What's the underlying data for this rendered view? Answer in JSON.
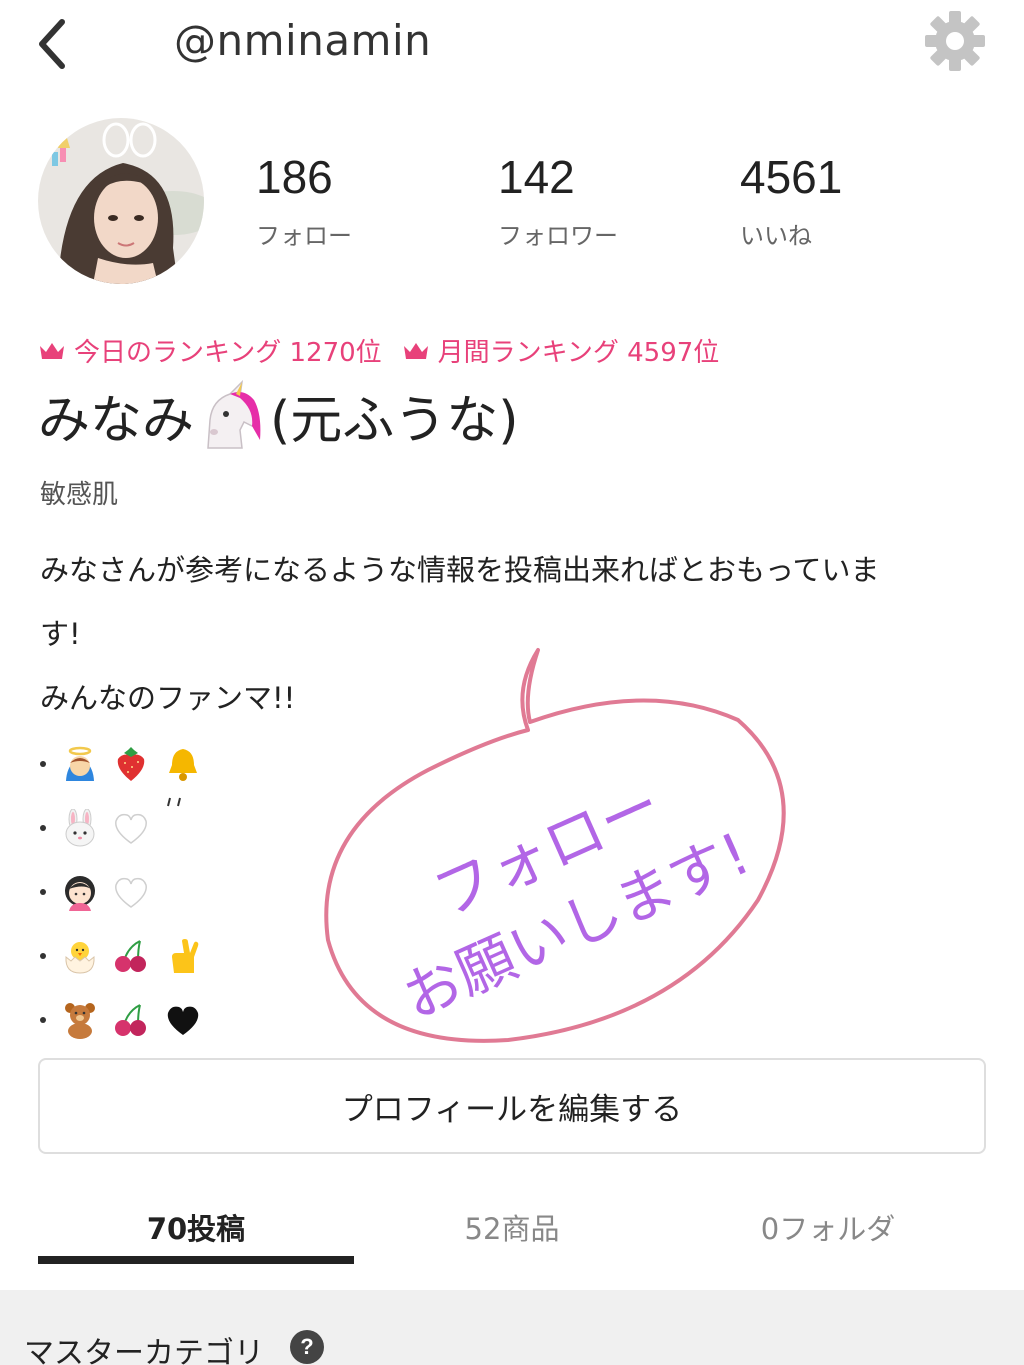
{
  "header": {
    "username": "@nminamin",
    "back_icon": "chevron-left-icon",
    "settings_icon": "gear-icon"
  },
  "stats": [
    {
      "value": "186",
      "label": "フォロー"
    },
    {
      "value": "142",
      "label": "フォロワー"
    },
    {
      "value": "4561",
      "label": "いいね"
    }
  ],
  "ranking": {
    "daily": "今日のランキング 1270位",
    "monthly": "月間ランキング 4597位",
    "icon": "crown-icon",
    "color": "#e8417a"
  },
  "profile": {
    "name_before": "みなみ",
    "name_after": "(元ふうな)",
    "name_emoji": "unicorn-icon",
    "skin_type": "敏感肌",
    "bio_line1": "みなさんが参考になるような情報を投稿出来ればとおもっていま",
    "bio_line2": "す!",
    "bio_line3": "みんなのファンマ!!",
    "fan_marks": [
      [
        "angel-icon",
        "strawberry-icon",
        "bell-icon"
      ],
      [
        "rabbit-icon",
        "white-heart-icon"
      ],
      [
        "girl-icon",
        "white-heart-icon"
      ],
      [
        "hatching-chick-icon",
        "cherries-icon",
        "crossed-fingers-icon"
      ],
      [
        "teddy-bear-icon",
        "cherries-icon",
        "black-heart-icon"
      ]
    ]
  },
  "overlay": {
    "line1": "フォロー",
    "line2": "お願いします!",
    "text_color": "#b266e6",
    "bubble_color": "#e07a94"
  },
  "edit_button": "プロフィールを編集する",
  "tabs": [
    {
      "label": "70投稿",
      "active": true
    },
    {
      "label": "52商品",
      "active": false
    },
    {
      "label": "0フォルダ",
      "active": false
    }
  ],
  "category": {
    "title": "マスターカテゴリ",
    "help_glyph": "?"
  }
}
